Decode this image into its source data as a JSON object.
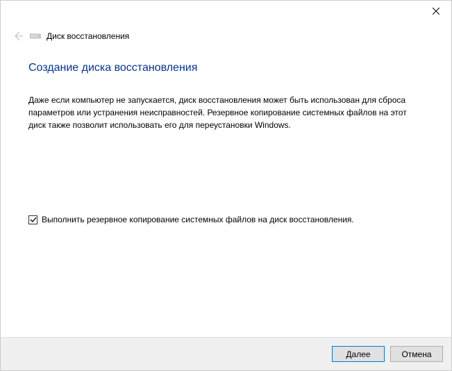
{
  "header": {
    "title": "Диск восстановления"
  },
  "main": {
    "heading": "Создание диска восстановления",
    "description": "Даже если компьютер не запускается, диск восстановления может быть использован для сброса параметров или устранения неисправностей. Резервное копирование системных файлов на этот диск также позволит использовать его для переустановки Windows.",
    "checkbox_label": "Выполнить резервное копирование системных файлов на диск восстановления.",
    "checkbox_checked": true
  },
  "footer": {
    "next_label": "Далее",
    "cancel_label": "Отмена"
  }
}
